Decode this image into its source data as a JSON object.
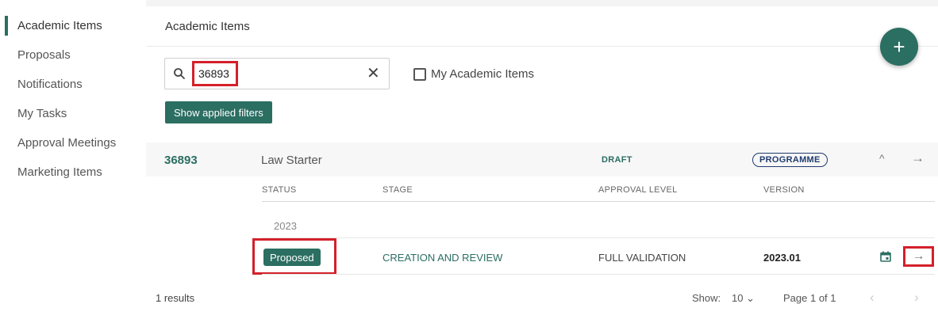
{
  "sidebar": {
    "items": [
      {
        "label": "Academic Items",
        "active": true
      },
      {
        "label": "Proposals"
      },
      {
        "label": "Notifications"
      },
      {
        "label": "My Tasks"
      },
      {
        "label": "Approval Meetings"
      },
      {
        "label": "Marketing Items"
      }
    ]
  },
  "main": {
    "title": "Academic Items",
    "fab_label": "+",
    "search": {
      "value": "36893",
      "placeholder": ""
    },
    "clear_label": "✕",
    "my_items_label": "My Academic Items",
    "filters_button": "Show applied filters"
  },
  "group": {
    "id": "36893",
    "name": "Law Starter",
    "status": "DRAFT",
    "type": "PROGRAMME",
    "columns": {
      "status": "STATUS",
      "stage": "STAGE",
      "approval_level": "APPROVAL LEVEL",
      "version": "VERSION"
    },
    "year": "2023",
    "row": {
      "status": "Proposed",
      "stage": "CREATION AND REVIEW",
      "approval_level": "FULL VALIDATION",
      "version": "2023.01"
    }
  },
  "footer": {
    "results": "1 results",
    "show_label": "Show:",
    "page_size": "10",
    "page_info": "Page 1 of 1"
  },
  "colors": {
    "accent": "#2b6e62",
    "highlight": "#d4202a",
    "type_badge": "#1f3b6e"
  }
}
